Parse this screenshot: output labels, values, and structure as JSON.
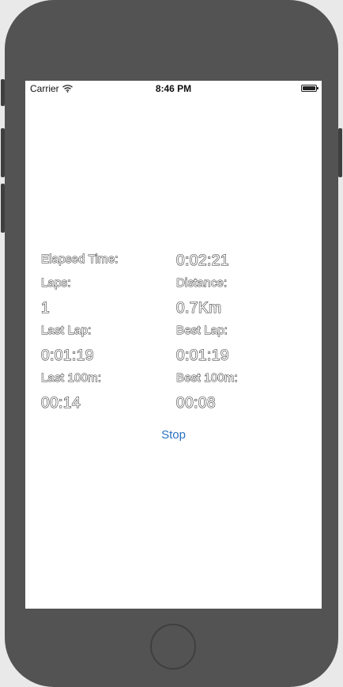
{
  "status_bar": {
    "carrier": "Carrier",
    "time": "8:46 PM",
    "wifi_icon": "wifi-icon",
    "battery_icon": "battery-icon",
    "battery_level": 0.95
  },
  "stats": {
    "elapsed_time_label": "Elapsed Time:",
    "elapsed_time_value": "0:02:21",
    "laps_label": "Laps:",
    "laps_value": "1",
    "distance_label": "Distance:",
    "distance_value": "0.7Km",
    "last_lap_label": "Last Lap:",
    "last_lap_value": "0:01:19",
    "best_lap_label": "Best Lap:",
    "best_lap_value": "0:01:19",
    "last_100m_label": "Last 100m:",
    "last_100m_value": "00:14",
    "best_100m_label": "Best 100m:",
    "best_100m_value": "00:08"
  },
  "actions": {
    "stop_label": "Stop"
  },
  "colors": {
    "device_body": "#535353",
    "accent": "#2a72c0"
  }
}
